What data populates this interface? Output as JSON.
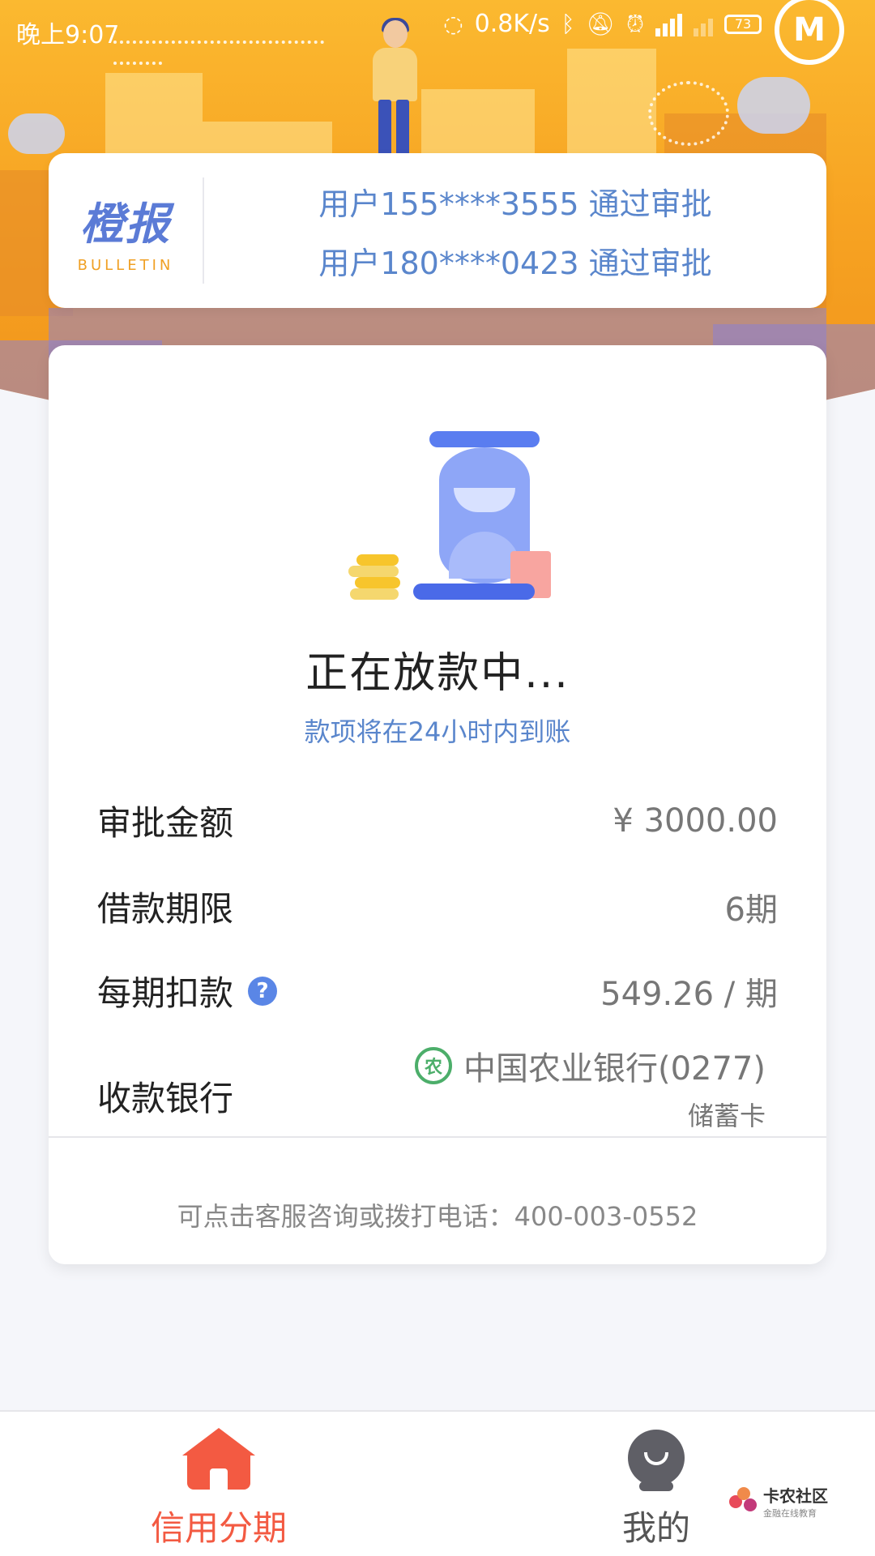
{
  "status_bar": {
    "time": "晚上9:07",
    "net_speed": "0.8K/s",
    "battery": "73"
  },
  "bulletin": {
    "logo_cn": "橙报",
    "logo_en": "BULLETIN",
    "messages": [
      "用户155****3555 通过审批",
      "用户180****0423 通过审批"
    ]
  },
  "loan_status": {
    "title": "正在放款中...",
    "subtitle": "款项将在24小时内到账"
  },
  "details": {
    "approved_amount": {
      "label": "审批金额",
      "value": "¥ 3000.00"
    },
    "loan_term": {
      "label": "借款期限",
      "value": "6期"
    },
    "installment": {
      "label": "每期扣款",
      "value": "549.26 / 期"
    },
    "bank": {
      "label": "收款银行",
      "value": "中国农业银行(0277)",
      "card_type": "储蓄卡"
    }
  },
  "help_text": "可点击客服咨询或拨打电话：400-003-0552",
  "bottom_nav": {
    "tabs": [
      {
        "label": "信用分期",
        "active": true
      },
      {
        "label": "我的",
        "active": false
      }
    ]
  },
  "watermark": {
    "name": "卡农社区",
    "tagline": "金融在线教育"
  },
  "colors": {
    "accent": "#f35a42",
    "link_blue": "#5a86cc",
    "hero_orange": "#f7a322",
    "bank_green": "#4cae6a"
  }
}
